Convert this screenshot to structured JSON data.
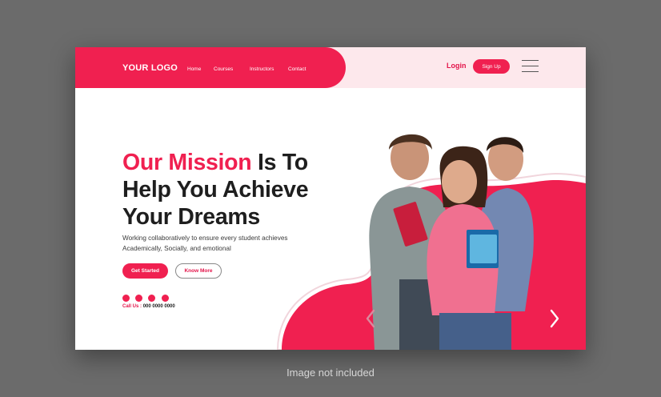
{
  "header": {
    "logo": "YOUR LOGO",
    "nav": [
      "Home",
      "Courses",
      "Instructors",
      "Contact"
    ],
    "login": "Login",
    "signup": "Sign Up"
  },
  "hero": {
    "title_highlight": "Our Mission",
    "title_line1_rest": " Is To",
    "title_line2": "Help You Achieve",
    "title_line3": "Your Dreams",
    "description_line1": "Working collaboratively to ensure every student achieves",
    "description_line2": "Academically, Socially, and emotional",
    "btn_primary": "Get Started",
    "btn_secondary": "Know More",
    "call_label": "Call Us : ",
    "call_number": "000 0000 0000",
    "social_icons": [
      "facebook-icon",
      "twitter-icon",
      "telegram-icon",
      "instagram-icon"
    ]
  },
  "caption": "Image not included",
  "colors": {
    "accent": "#f02050",
    "header_tint": "#fde8ec",
    "frame": "#6b6b6b"
  }
}
